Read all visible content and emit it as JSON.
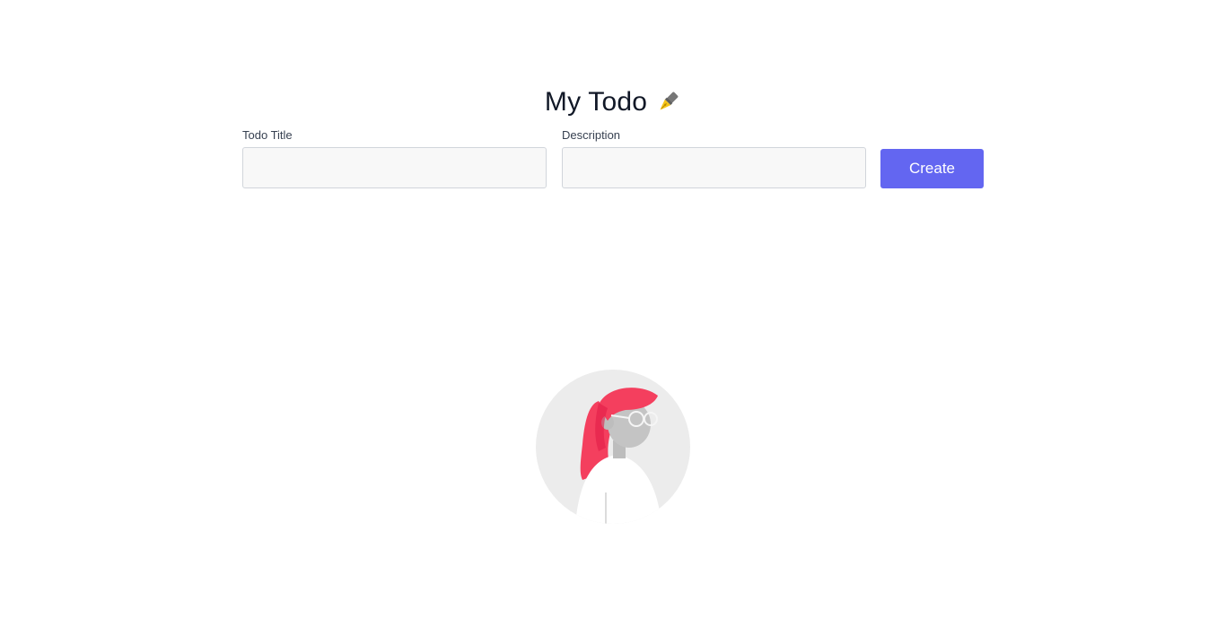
{
  "header": {
    "title": "My Todo",
    "icon": "fountain-pen-icon"
  },
  "form": {
    "title_label": "Todo Title",
    "title_value": "",
    "title_placeholder": "",
    "description_label": "Description",
    "description_value": "",
    "description_placeholder": "",
    "create_label": "Create"
  },
  "empty_state": {
    "illustration": "empty-state-person-illustration"
  },
  "colors": {
    "accent": "#6366f1",
    "input_background": "#f8f8f8",
    "hair": "#f43f5e",
    "avatar_background": "#ececec"
  }
}
